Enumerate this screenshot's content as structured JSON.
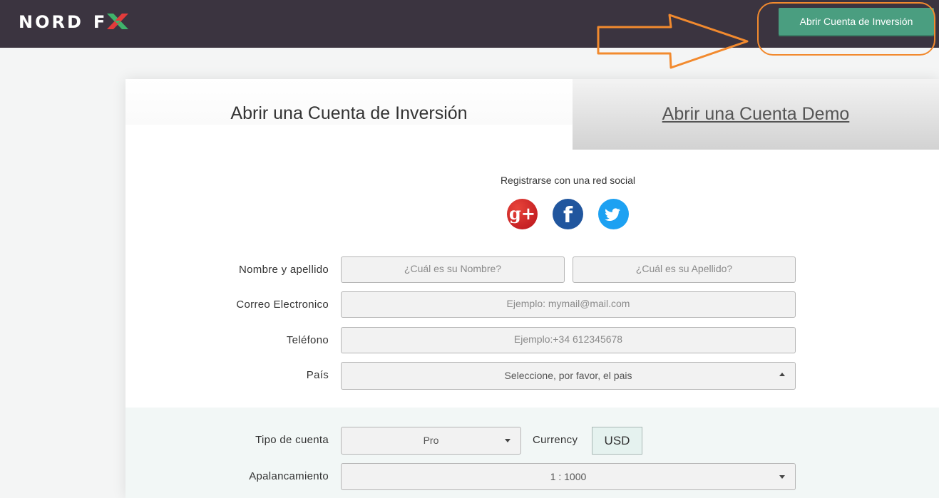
{
  "header": {
    "logo_nord": "NORD",
    "logo_f": "F",
    "logo_x": "X",
    "open_account_button": "Abrir Cuenta de Inversión"
  },
  "tabs": {
    "active": "Abrir una Cuenta de Inversión",
    "demo": "Abrir una Cuenta Demo"
  },
  "social": {
    "label": "Registrarse con una red social",
    "google_text": "g+",
    "facebook_text": "f"
  },
  "form": {
    "name_label": "Nombre y apellido",
    "first_name_placeholder": "¿Cuál es su Nombre?",
    "last_name_placeholder": "¿Cuál es su Apellido?",
    "email_label": "Correo Electronico",
    "email_placeholder": "Ejemplo: mymail@mail.com",
    "phone_label": "Teléfono",
    "phone_placeholder": "Ejemplo:+34 612345678",
    "country_label": "País",
    "country_value": "Seleccione, por favor, el pais",
    "account_type_label": "Tipo de cuenta",
    "account_type_value": "Pro",
    "currency_label": "Currency",
    "currency_value": "USD",
    "leverage_label": "Apalancamiento",
    "leverage_value": "1 : 1000"
  },
  "colors": {
    "topbar": "#3b3440",
    "accent_button": "#4a9e80",
    "annotation": "#f28a2e",
    "logo_x_green": "#3fb36b",
    "logo_x_red": "#e23b3b"
  },
  "icons": [
    "google-plus-icon",
    "facebook-icon",
    "twitter-icon",
    "caret-down-icon",
    "caret-up-icon",
    "annotation-arrow-icon"
  ]
}
